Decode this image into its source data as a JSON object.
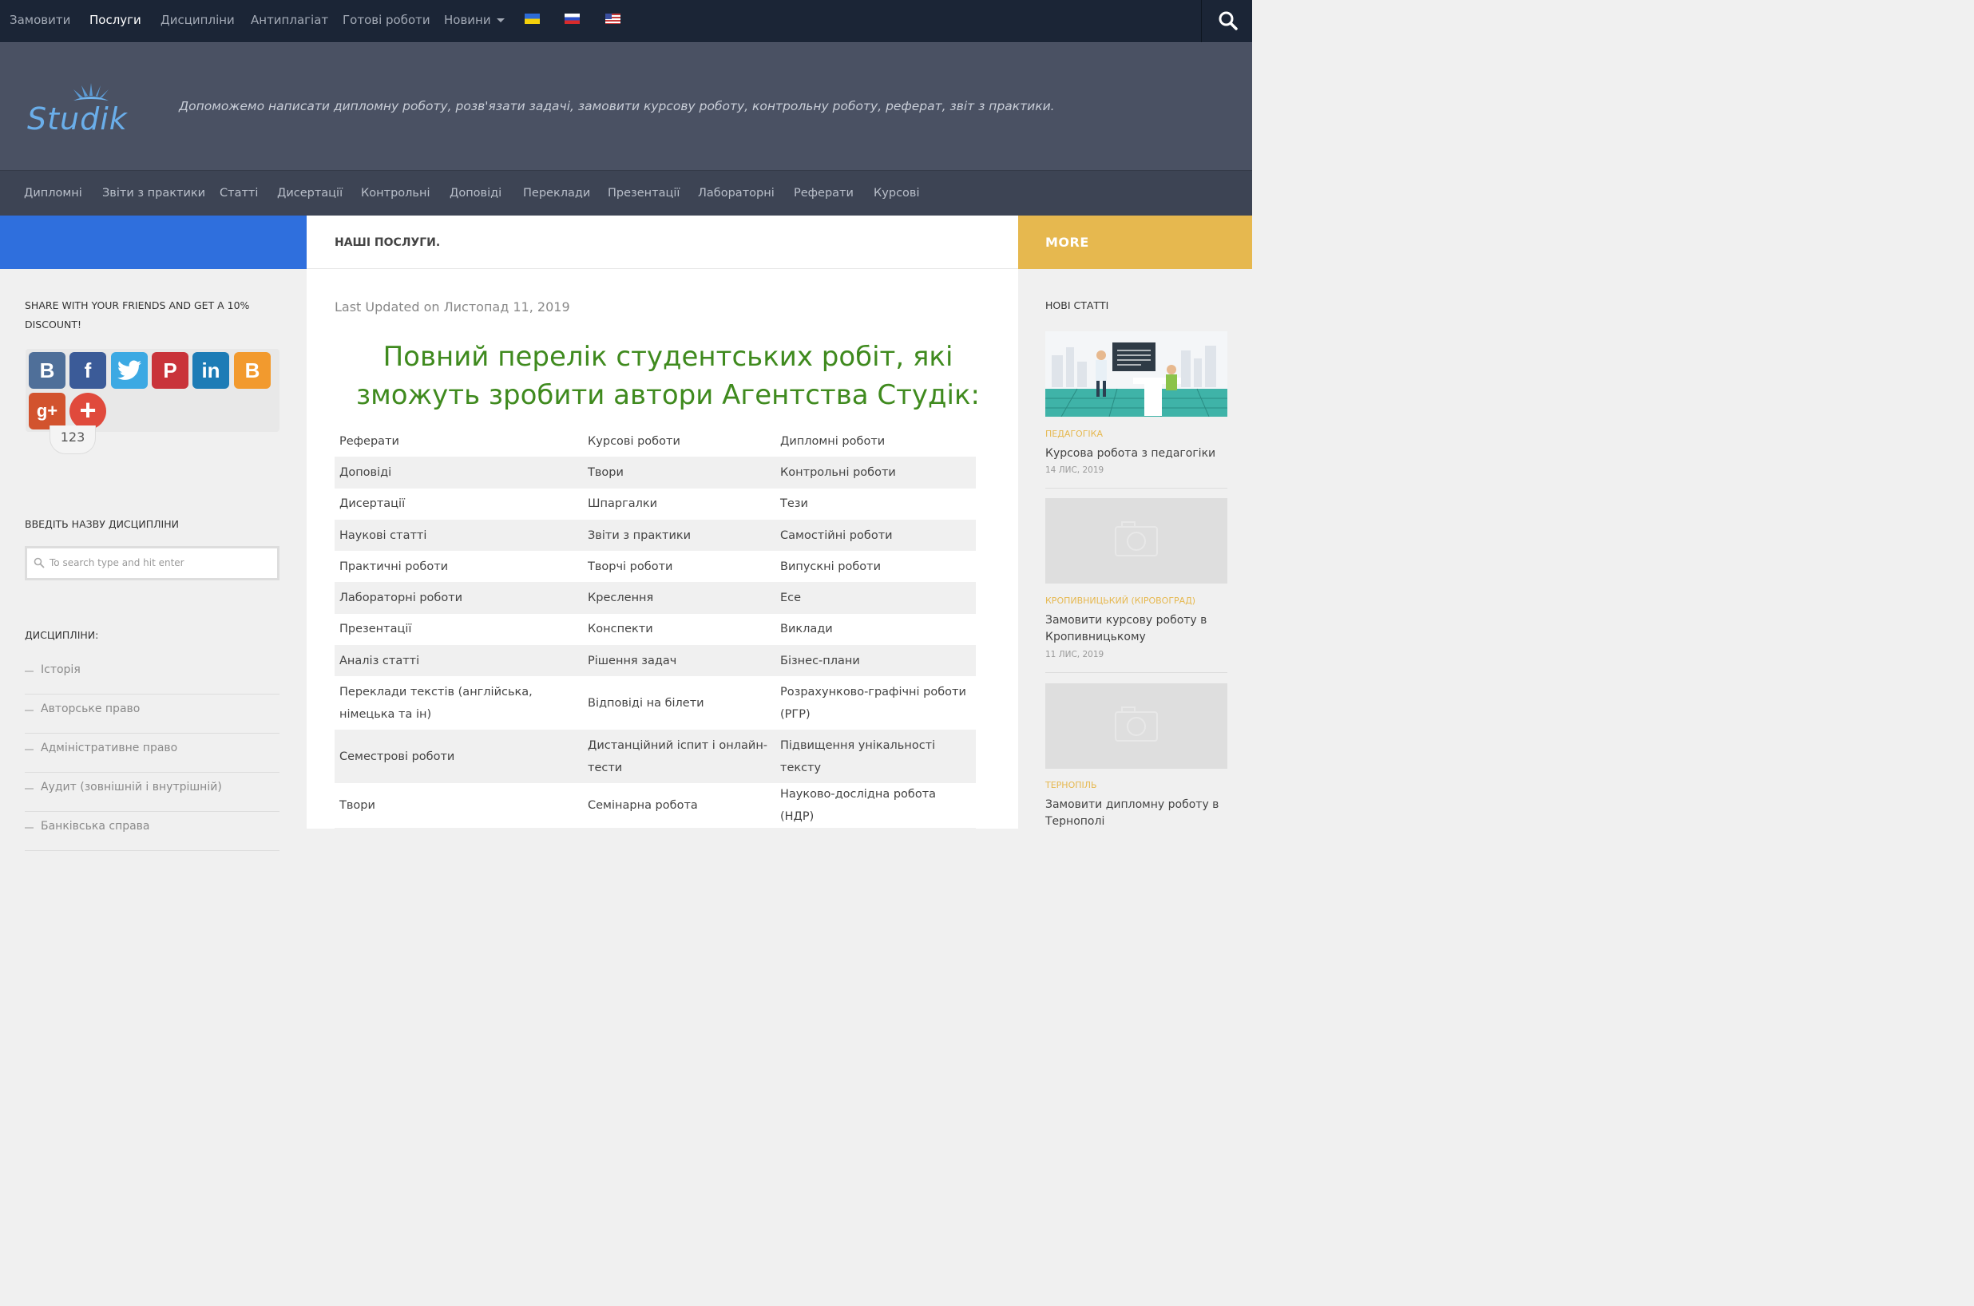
{
  "topnav": {
    "items": [
      "Замовити",
      "Послуги",
      "Дисципліни",
      "Антиплагіат",
      "Готові роботи",
      "Новини"
    ],
    "active": "Послуги",
    "flags": [
      "flag-ua-icon",
      "flag-ru-icon",
      "flag-us-icon"
    ]
  },
  "header": {
    "logo_text": "Studik",
    "tagline": "Допоможемо написати дипломну роботу, розв'язати задачі, замовити курсову роботу, контрольну роботу, реферат, звіт з практики."
  },
  "subnav": {
    "items": [
      "Дипломні",
      "Звіти з практики",
      "Статті",
      "Дисертації",
      "Контрольні",
      "Доповіді",
      "Переклади",
      "Презентації",
      "Лабораторні",
      "Реферати",
      "Курсові"
    ]
  },
  "band": {
    "page_title": "НАШІ ПОСЛУГИ.",
    "more_label": "MORE",
    "colors": {
      "blue": "#2f6fdd",
      "yellow": "#e6b84f"
    }
  },
  "left_sidebar": {
    "share_title": "SHARE WITH YOUR FRIENDS AND GET A 10% DISCOUNT!",
    "share_buttons": [
      "vk-icon",
      "facebook-icon",
      "twitter-icon",
      "pinterest-icon",
      "linkedin-icon",
      "blogger-icon",
      "google-plus-icon",
      "add-more-icon"
    ],
    "share_count": "123",
    "search_title": "ВВЕДІТЬ НАЗВУ ДИСЦИПЛІНИ",
    "search_placeholder": "To search type and hit enter",
    "disciplines_title": "ДИСЦИПЛІНИ:",
    "disciplines": [
      "Історія",
      "Авторське право",
      "Адміністративне право",
      "Аудит (зовнішній і внутрішній)",
      "Банківська справа"
    ]
  },
  "main": {
    "updated": "Last Updated on Листопад 11, 2019",
    "headline": "Повний перелік студентських робіт, які зможуть зробити автори Агентства Студік:",
    "rows": [
      [
        "Реферати",
        "Курсові роботи",
        "Дипломні роботи"
      ],
      [
        "Доповіді",
        "Твори",
        "Контрольні роботи"
      ],
      [
        "Дисертації",
        "Шпаргалки",
        "Тези"
      ],
      [
        "Наукові статті",
        "Звіти з практики",
        "Самостійні роботи"
      ],
      [
        "Практичні роботи",
        "Творчі роботи",
        "Випускні роботи"
      ],
      [
        "Лабораторні роботи",
        "Креслення",
        "Есе"
      ],
      [
        "Презентації",
        "Конспекти",
        "Виклади"
      ],
      [
        "Аналіз статті",
        "Рішення задач",
        "Бізнес-плани"
      ],
      [
        "Переклади текстів (англійська, німецька та ін)",
        "Відповіді на білети",
        "Розрахунково-графічні роботи (РГР)"
      ],
      [
        "Семестрові роботи",
        "Дистанційний іспит і онлайн-тести",
        "Підвищення унікальності тексту"
      ],
      [
        "Твори",
        " Семінарна робота",
        "Науково-дослідна робота (НДР)"
      ],
      [
        "",
        "",
        ""
      ]
    ]
  },
  "right_sidebar": {
    "title": "НОВІ СТАТТІ",
    "posts": [
      {
        "category": "ПЕДАГОГІКА",
        "title": "Курсова робота з педагогіки",
        "date": "14 ЛИС, 2019"
      },
      {
        "category": "КРОПИВНИЦЬКИЙ (КІРОВОГРАД)",
        "title": "Замовити курсову роботу в Кропивницькому",
        "date": "11 ЛИС, 2019"
      },
      {
        "category": "ТЕРНОПІЛЬ",
        "title": "Замовити дипломну роботу в Тернополі",
        "date": ""
      }
    ]
  }
}
